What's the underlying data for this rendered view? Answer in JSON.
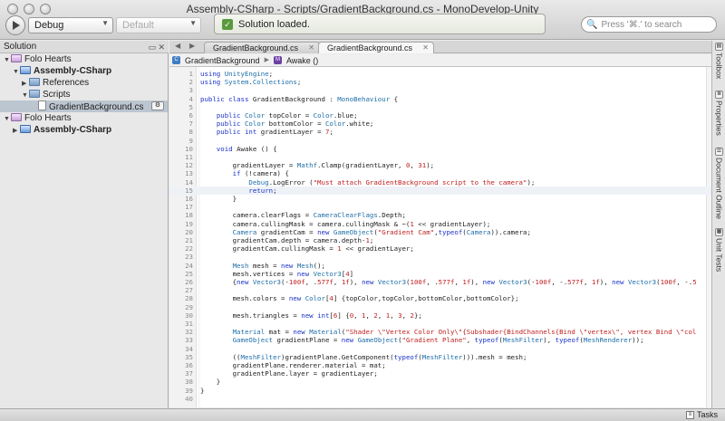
{
  "window": {
    "title": "Assembly-CSharp - Scripts/GradientBackground.cs - MonoDevelop-Unity"
  },
  "toolbar": {
    "config": "Debug",
    "platform": "Default",
    "status": "Solution loaded.",
    "search_placeholder": "Press '⌘.' to search"
  },
  "solution_pad": {
    "title": "Solution",
    "items": [
      {
        "label": "Folo Hearts",
        "icon": "solution-icon",
        "bold": false,
        "expand": "▼",
        "indent": 0
      },
      {
        "label": "Assembly-CSharp",
        "icon": "project-icon",
        "bold": true,
        "expand": "▼",
        "indent": 1
      },
      {
        "label": "References",
        "icon": "folder-icon",
        "bold": false,
        "expand": "▶",
        "indent": 2
      },
      {
        "label": "Scripts",
        "icon": "folder-icon",
        "bold": false,
        "expand": "▼",
        "indent": 2
      },
      {
        "label": "GradientBackground.cs",
        "icon": "file-icon",
        "bold": false,
        "expand": "",
        "indent": 3,
        "selected": true
      },
      {
        "label": "Folo Hearts",
        "icon": "solution-icon",
        "bold": false,
        "expand": "▼",
        "indent": 0
      },
      {
        "label": "Assembly-CSharp",
        "icon": "project-icon",
        "bold": true,
        "expand": "▶",
        "indent": 1
      }
    ]
  },
  "tabs": [
    {
      "label": "GradientBackground.cs",
      "active": false
    },
    {
      "label": "GradientBackground.cs",
      "active": true
    }
  ],
  "breadcrumb": {
    "class_name": "GradientBackground",
    "method_name": "Awake ()"
  },
  "code": [
    {
      "n": "1",
      "t": "using UnityEngine;"
    },
    {
      "n": "2",
      "t": "using System.Collections;"
    },
    {
      "n": "3",
      "t": ""
    },
    {
      "n": "4",
      "t": "public class GradientBackground : MonoBehaviour {"
    },
    {
      "n": "5",
      "t": ""
    },
    {
      "n": "6",
      "t": "    public Color topColor = Color.blue;"
    },
    {
      "n": "7",
      "t": "    public Color bottomColor = Color.white;"
    },
    {
      "n": "8",
      "t": "    public int gradientLayer = 7;"
    },
    {
      "n": "9",
      "t": ""
    },
    {
      "n": "10",
      "t": "    void Awake () {"
    },
    {
      "n": "11",
      "t": ""
    },
    {
      "n": "12",
      "t": "        gradientLayer = Mathf.Clamp(gradientLayer, 0, 31);"
    },
    {
      "n": "13",
      "t": "        if (!camera) {"
    },
    {
      "n": "14",
      "t": "            Debug.LogError (\"Must attach GradientBackground script to the camera\");"
    },
    {
      "n": "15",
      "t": "            return;"
    },
    {
      "n": "16",
      "t": "        }"
    },
    {
      "n": "17",
      "t": ""
    },
    {
      "n": "18",
      "t": "        camera.clearFlags = CameraClearFlags.Depth;"
    },
    {
      "n": "19",
      "t": "        camera.cullingMask = camera.cullingMask & ~(1 << gradientLayer);"
    },
    {
      "n": "20",
      "t": "        Camera gradientCam = new GameObject(\"Gradient Cam\",typeof(Camera)).camera;"
    },
    {
      "n": "21",
      "t": "        gradientCam.depth = camera.depth-1;"
    },
    {
      "n": "22",
      "t": "        gradientCam.cullingMask = 1 << gradientLayer;"
    },
    {
      "n": "23",
      "t": ""
    },
    {
      "n": "24",
      "t": "        Mesh mesh = new Mesh();"
    },
    {
      "n": "25",
      "t": "        mesh.vertices = new Vector3[4]"
    },
    {
      "n": "26",
      "t": "        {new Vector3(-100f, .577f, 1f), new Vector3(100f, .577f, 1f), new Vector3(-100f, -.577f, 1f), new Vector3(100f, -.5"
    },
    {
      "n": "27",
      "t": ""
    },
    {
      "n": "28",
      "t": "        mesh.colors = new Color[4] {topColor,topColor,bottomColor,bottomColor};"
    },
    {
      "n": "29",
      "t": ""
    },
    {
      "n": "30",
      "t": "        mesh.triangles = new int[6] {0, 1, 2, 1, 3, 2};"
    },
    {
      "n": "31",
      "t": ""
    },
    {
      "n": "32",
      "t": "        Material mat = new Material(\"Shader \\\"Vertex Color Only\\\"{Subshader{BindChannels{Bind \\\"vertex\\\", vertex Bind \\\"col"
    },
    {
      "n": "33",
      "t": "        GameObject gradientPlane = new GameObject(\"Gradient Plane\", typeof(MeshFilter), typeof(MeshRenderer));"
    },
    {
      "n": "34",
      "t": ""
    },
    {
      "n": "35",
      "t": "        ((MeshFilter)gradientPlane.GetComponent(typeof(MeshFilter))).mesh = mesh;"
    },
    {
      "n": "36",
      "t": "        gradientPlane.renderer.material = mat;"
    },
    {
      "n": "37",
      "t": "        gradientPlane.layer = gradientLayer;"
    },
    {
      "n": "38",
      "t": "    }"
    },
    {
      "n": "39",
      "t": "}"
    },
    {
      "n": "40",
      "t": ""
    }
  ],
  "current_line": "15",
  "right_dock": [
    {
      "label": "Toolbox",
      "icon": "toolbox-icon"
    },
    {
      "label": "Properties",
      "icon": "properties-icon"
    },
    {
      "label": "Document Outline",
      "icon": "outline-icon"
    },
    {
      "label": "Unit Tests",
      "icon": "unit-tests-icon"
    }
  ],
  "statusbar": {
    "tasks": "Tasks"
  },
  "colors": {
    "keyword": "#1a32c8",
    "type": "#1d6ea8",
    "string": "#c02020",
    "number": "#c02020",
    "selection": "#bcc6d1"
  }
}
